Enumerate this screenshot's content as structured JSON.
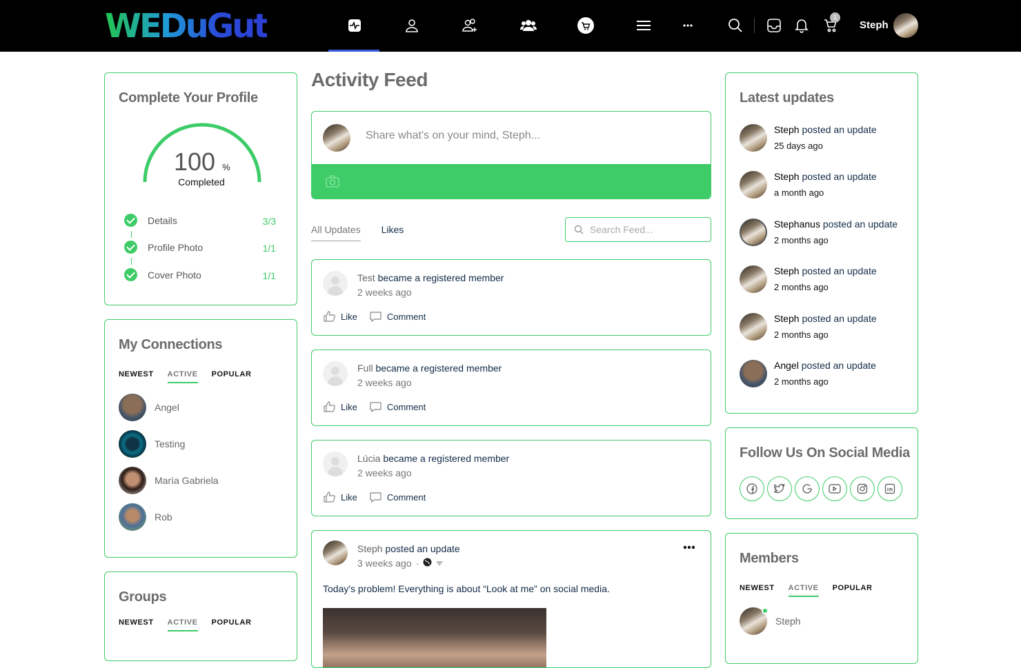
{
  "brand": {
    "logo_text": "WEDuGut",
    "accent": "#3dcc67"
  },
  "header": {
    "nav_icons": [
      "activity-icon",
      "profile-icon",
      "friends-icon",
      "groups-icon",
      "shop-icon",
      "menu-icon",
      "more-icon"
    ],
    "cart_count": "1",
    "user_name": "Steph"
  },
  "profile_widget": {
    "title": "Complete Your Profile",
    "percent": "100",
    "percent_sign": "%",
    "completed_label": "Completed",
    "steps": [
      {
        "label": "Details",
        "value": "3/3"
      },
      {
        "label": "Profile Photo",
        "value": "1/1"
      },
      {
        "label": "Cover Photo",
        "value": "1/1"
      }
    ]
  },
  "connections_widget": {
    "title": "My Connections",
    "tabs": [
      "NEWEST",
      "ACTIVE",
      "POPULAR"
    ],
    "members": [
      {
        "name": "Angel"
      },
      {
        "name": "Testing"
      },
      {
        "name": "María Gabriela"
      },
      {
        "name": "Rob"
      }
    ]
  },
  "groups_widget": {
    "title": "Groups",
    "tabs": [
      "NEWEST",
      "ACTIVE",
      "POPULAR"
    ]
  },
  "feed": {
    "title": "Activity Feed",
    "composer_placeholder": "Share what's on your mind, Steph...",
    "tabs": [
      "All Updates",
      "Likes"
    ],
    "search_placeholder": "Search Feed...",
    "activities": [
      {
        "who": "Test",
        "action": " became a registered member",
        "time": "2 weeks ago",
        "like": "Like",
        "comment": "Comment"
      },
      {
        "who": "Full",
        "action": " became a registered member",
        "time": "2 weeks ago",
        "like": "Like",
        "comment": "Comment"
      },
      {
        "who": "Lúcia",
        "action": " became a registered member",
        "time": "2 weeks ago",
        "like": "Like",
        "comment": "Comment"
      }
    ],
    "post": {
      "who": "Steph",
      "action": " posted an update",
      "time": "3 weeks ago",
      "separator": "·",
      "text": "Today's problem! Everything is about “Look at me” on social media."
    }
  },
  "updates_widget": {
    "title": "Latest updates",
    "items": [
      {
        "who": "Steph",
        "action": " posted an update",
        "time": "25 days ago"
      },
      {
        "who": "Steph",
        "action": " posted an update",
        "time": "a month ago"
      },
      {
        "who": "Stephanus",
        "action": " posted an update",
        "time": "2 months ago"
      },
      {
        "who": "Steph",
        "action": " posted an update",
        "time": "2 months ago"
      },
      {
        "who": "Steph",
        "action": " posted an update",
        "time": "2 months ago"
      },
      {
        "who": "Angel",
        "action": " posted an update",
        "time": "2 months ago"
      }
    ]
  },
  "social_widget": {
    "title": "Follow Us On Social Media",
    "icons": [
      "facebook-icon",
      "twitter-icon",
      "google-icon",
      "youtube-icon",
      "instagram-icon",
      "linkedin-icon"
    ]
  },
  "members_widget": {
    "title": "Members",
    "tabs": [
      "NEWEST",
      "ACTIVE",
      "POPULAR"
    ],
    "members": [
      {
        "name": "Steph"
      }
    ]
  }
}
